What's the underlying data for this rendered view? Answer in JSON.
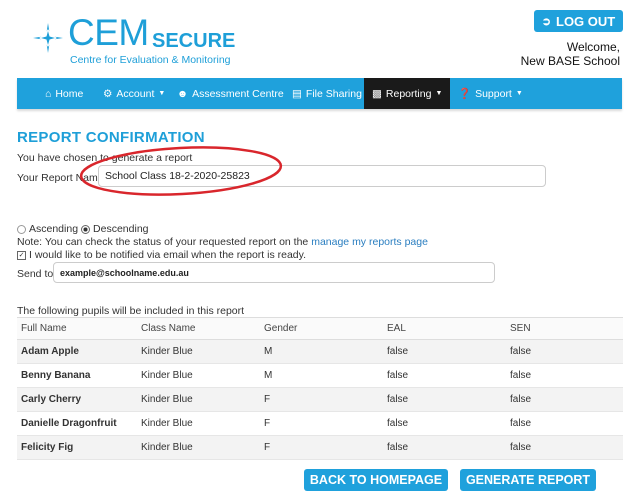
{
  "logo": {
    "main": "CEM",
    "secure": "SECURE",
    "tagline": "Centre for Evaluation & Monitoring"
  },
  "logout": {
    "label": "LOG OUT"
  },
  "welcome": {
    "line1": "Welcome,",
    "line2": "New BASE School"
  },
  "nav": [
    {
      "label": "Home",
      "icon": "home-icon"
    },
    {
      "label": "Account",
      "icon": "gear-icon",
      "dropdown": true
    },
    {
      "label": "Assessment Centre",
      "icon": "users-icon"
    },
    {
      "label": "File Sharing",
      "icon": "file-icon"
    },
    {
      "label": "Reporting",
      "icon": "bar-chart-icon",
      "dropdown": true,
      "active": true
    },
    {
      "label": "Support",
      "icon": "question-icon",
      "dropdown": true
    }
  ],
  "page": {
    "title": "REPORT CONFIRMATION",
    "chosen_text": "You have chosen to generate a report",
    "report_name_label": "Your Report Name",
    "report_name_value": "School Class 18-2-2020-25823",
    "sort": {
      "ascending": "Ascending",
      "descending": "Descending",
      "selected": "Descending"
    },
    "note_prefix": "Note: You can check the status of your requested report on the",
    "note_link": "manage my reports page",
    "notify_label": "I would like to be notified via email when the report is ready.",
    "notify_checked": true,
    "send_to_label": "Send to",
    "send_to_value": "example@schoolname.edu.au",
    "pupils_caption": "The following pupils will be included in this report"
  },
  "table": {
    "columns": [
      "Full Name",
      "Class Name",
      "Gender",
      "EAL",
      "SEN"
    ],
    "rows": [
      [
        "Adam Apple",
        "Kinder Blue",
        "M",
        "false",
        "false"
      ],
      [
        "Benny Banana",
        "Kinder Blue",
        "M",
        "false",
        "false"
      ],
      [
        "Carly Cherry",
        "Kinder Blue",
        "F",
        "false",
        "false"
      ],
      [
        "Danielle Dragonfruit",
        "Kinder Blue",
        "F",
        "false",
        "false"
      ],
      [
        "Felicity Fig",
        "Kinder Blue",
        "F",
        "false",
        "false"
      ]
    ]
  },
  "buttons": {
    "back": "BACK TO HOMEPAGE",
    "generate": "GENERATE REPORT"
  },
  "colors": {
    "brand": "#1fa1dc",
    "nav_active": "#1a1a1a",
    "annotation": "#d9262c"
  }
}
